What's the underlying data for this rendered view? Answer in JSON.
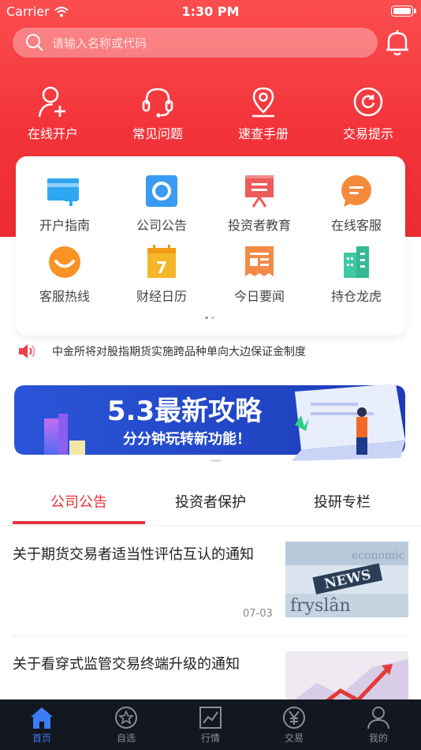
{
  "status_bar": {
    "carrier": "Carrier",
    "time": "1:30 PM"
  },
  "search": {
    "placeholder": "请输入名称或代码"
  },
  "quick_actions": [
    {
      "label": "在线开户",
      "icon": "user-add-icon"
    },
    {
      "label": "常见问题",
      "icon": "headset-icon"
    },
    {
      "label": "速查手册",
      "icon": "location-pin-icon"
    },
    {
      "label": "交易提示",
      "icon": "refresh-circle-icon"
    }
  ],
  "grid": [
    {
      "label": "开户指南",
      "icon": "card-plus-icon"
    },
    {
      "label": "公司公告",
      "icon": "announcement-icon"
    },
    {
      "label": "投资者教育",
      "icon": "presentation-icon"
    },
    {
      "label": "在线客服",
      "icon": "chat-icon"
    },
    {
      "label": "客服热线",
      "icon": "smile-icon"
    },
    {
      "label": "财经日历",
      "icon": "calendar-icon"
    },
    {
      "label": "今日要闻",
      "icon": "receipt-icon"
    },
    {
      "label": "持仓龙虎",
      "icon": "buildings-icon"
    }
  ],
  "ticker": {
    "text": "中金所将对股指期货实施跨品种单向大边保证金制度",
    "icon": "speaker-icon"
  },
  "banner": {
    "title": "5.3最新攻略",
    "subtitle": "分分钟玩转新功能！"
  },
  "tabs": [
    {
      "label": "公司公告",
      "active": true
    },
    {
      "label": "投资者保护",
      "active": false
    },
    {
      "label": "投研专栏",
      "active": false
    }
  ],
  "news": [
    {
      "title": "关于期货交易者适当性评估互认的通知",
      "date": "07-03",
      "thumb_text": "NEWS"
    },
    {
      "title": "关于看穿式监管交易终端升级的通知",
      "date": ""
    }
  ],
  "tabbar": [
    {
      "label": "首页",
      "icon": "home-icon",
      "active": true
    },
    {
      "label": "自选",
      "icon": "star-icon",
      "active": false
    },
    {
      "label": "行情",
      "icon": "chart-icon",
      "active": false
    },
    {
      "label": "交易",
      "icon": "yen-icon",
      "active": false
    },
    {
      "label": "我的",
      "icon": "person-icon",
      "active": false
    }
  ],
  "colors": {
    "brand_red": "#e8323a",
    "tab_active_blue": "#3c7cf6",
    "tabbar_bg": "#131722"
  }
}
